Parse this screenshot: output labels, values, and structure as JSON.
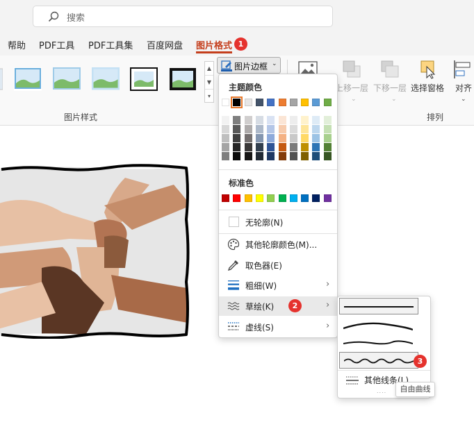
{
  "search": {
    "placeholder": "搜索"
  },
  "tabs": [
    {
      "label": "帮助"
    },
    {
      "label": "PDF工具"
    },
    {
      "label": "PDF工具集"
    },
    {
      "label": "百度网盘"
    },
    {
      "label": "图片格式",
      "active": true
    }
  ],
  "badges": {
    "one": "1",
    "two": "2",
    "three": "3"
  },
  "ribbon": {
    "picture_styles_label": "图片样式",
    "border_button_label": "图片边框",
    "bring_forward": "上移一层",
    "send_backward": "下移一层",
    "selection_pane": "选择窗格",
    "align": "对齐",
    "arrange_label": "排列"
  },
  "menu": {
    "theme_colors_label": "主题颜色",
    "standard_colors_label": "标准色",
    "no_outline": "无轮廓(N)",
    "more_colors": "其他轮廓颜色(M)...",
    "eyedropper": "取色器(E)",
    "weight": "粗细(W)",
    "sketched": "草绘(K)",
    "dashes": "虚线(S)",
    "theme_top_row": [
      "#ffffff",
      "#000000",
      "#e7e6e6",
      "#44546a",
      "#4472c4",
      "#ed7d31",
      "#a5a5a5",
      "#ffc000",
      "#5b9bd5",
      "#70ad47"
    ],
    "theme_shades": [
      [
        "#f2f2f2",
        "#7f7f7f",
        "#d0cece",
        "#d6dce4",
        "#d9e2f3",
        "#fbe5d5",
        "#ededed",
        "#fff2cc",
        "#deebf6",
        "#e2efd9"
      ],
      [
        "#d8d8d8",
        "#595959",
        "#aeabab",
        "#adb9ca",
        "#b4c6e7",
        "#f7cbac",
        "#dbdbdb",
        "#fee599",
        "#bdd7ee",
        "#c5e0b3"
      ],
      [
        "#bfbfbf",
        "#3f3f3f",
        "#757070",
        "#8496b0",
        "#8eaadb",
        "#f4b183",
        "#c9c9c9",
        "#ffd965",
        "#9cc3e5",
        "#a8d08d"
      ],
      [
        "#a5a5a5",
        "#262626",
        "#3a3838",
        "#323f4f",
        "#2f5496",
        "#c55a11",
        "#7b7b7b",
        "#bf9000",
        "#2e75b5",
        "#538135"
      ],
      [
        "#7f7f7f",
        "#0c0c0c",
        "#171616",
        "#222a35",
        "#1f3864",
        "#833c0b",
        "#525252",
        "#7f6000",
        "#1e4e79",
        "#375623"
      ]
    ],
    "standard_row": [
      "#c00000",
      "#ff0000",
      "#ffc000",
      "#ffff00",
      "#92d050",
      "#00b050",
      "#00b0f0",
      "#0070c0",
      "#002060",
      "#7030a0"
    ]
  },
  "submenu": {
    "more_lines": "其他线条(L)...",
    "tooltip": "自由曲线"
  },
  "icons": {
    "search": "search-icon",
    "border": "pen-border-icon",
    "palette": "palette-icon",
    "eyedropper": "eyedropper-icon",
    "weight": "line-weight-icon",
    "sketch": "sketch-wave-icon",
    "dash": "dash-lines-icon"
  },
  "colors": {
    "accent": "#c43e1c",
    "badge": "#e5322d"
  }
}
